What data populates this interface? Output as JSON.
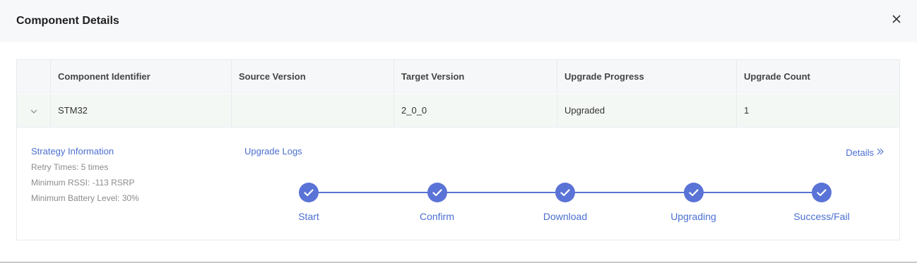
{
  "modal": {
    "title": "Component Details",
    "close_icon": "close-icon"
  },
  "table": {
    "columns": [
      "",
      "Component Identifier",
      "Source Version",
      "Target Version",
      "Upgrade Progress",
      "Upgrade Count"
    ],
    "rows": [
      {
        "expand_icon": "chevron-down-icon",
        "component_identifier": "STM32",
        "source_version": "",
        "target_version": "2_0_0",
        "upgrade_progress": "Upgraded",
        "upgrade_count": "1"
      }
    ]
  },
  "expanded": {
    "strategy": {
      "title": "Strategy Information",
      "retry_times": "Retry Times: 5 times",
      "min_rssi": "Minimum RSSI: -113 RSRP",
      "min_battery": "Minimum Battery Level: 30%"
    },
    "upgrade_logs_label": "Upgrade Logs",
    "details_label": "Details",
    "details_icon": "double-chevron-right-icon",
    "steps": [
      {
        "label": "Start",
        "status": "done"
      },
      {
        "label": "Confirm",
        "status": "done"
      },
      {
        "label": "Download",
        "status": "done"
      },
      {
        "label": "Upgrading",
        "status": "done"
      },
      {
        "label": "Success/Fail",
        "status": "done"
      }
    ]
  },
  "colors": {
    "accent": "#5a73d6",
    "link": "#4a6fd1"
  }
}
